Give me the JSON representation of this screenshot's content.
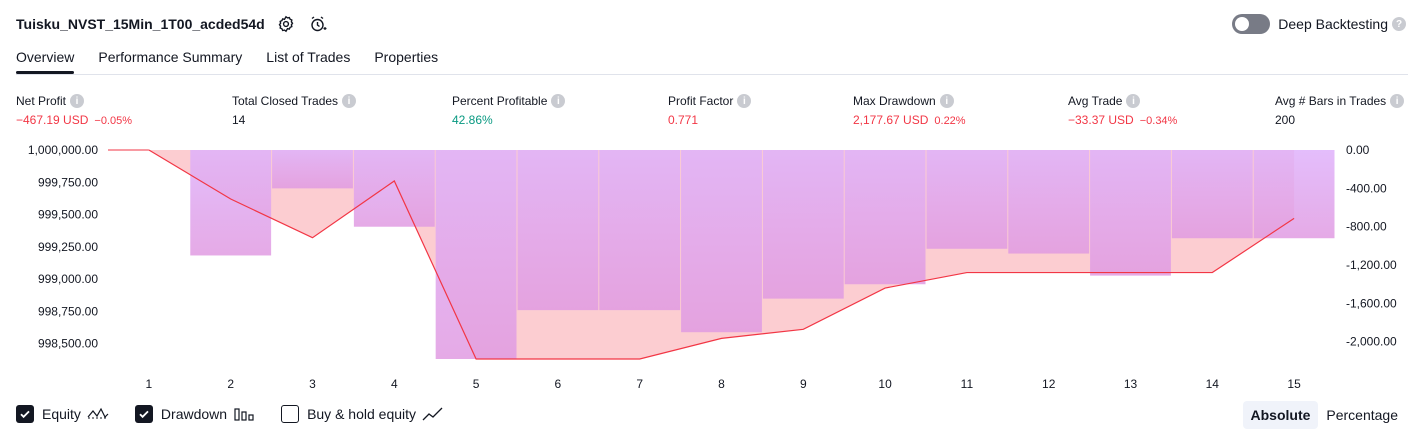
{
  "header": {
    "strategy_title": "Tuisku_NVST_15Min_1T00_acded54d",
    "deep_backtesting_label": "Deep Backtesting",
    "deep_backtesting_enabled": false
  },
  "tabs": [
    {
      "label": "Overview",
      "active": true
    },
    {
      "label": "Performance Summary",
      "active": false
    },
    {
      "label": "List of Trades",
      "active": false
    },
    {
      "label": "Properties",
      "active": false
    }
  ],
  "stats": [
    {
      "label": "Net Profit",
      "value": "−467.19 USD",
      "pct": "−0.05%",
      "tone": "neg"
    },
    {
      "label": "Total Closed Trades",
      "value": "14",
      "pct": "",
      "tone": "neu"
    },
    {
      "label": "Percent Profitable",
      "value": "42.86%",
      "pct": "",
      "tone": "pos"
    },
    {
      "label": "Profit Factor",
      "value": "0.771",
      "pct": "",
      "tone": "neg"
    },
    {
      "label": "Max Drawdown",
      "value": "2,177.67 USD",
      "pct": "0.22%",
      "tone": "neg"
    },
    {
      "label": "Avg Trade",
      "value": "−33.37 USD",
      "pct": "−0.34%",
      "tone": "neg"
    },
    {
      "label": "Avg # Bars in Trades",
      "value": "200",
      "pct": "",
      "tone": "neu"
    }
  ],
  "chart_data": {
    "type": "line",
    "x": [
      1,
      2,
      3,
      4,
      5,
      6,
      7,
      8,
      9,
      10,
      11,
      12,
      13,
      14,
      15
    ],
    "left_axis": {
      "ticks": [
        "1,000,000.00",
        "999,750.00",
        "999,500.00",
        "999,250.00",
        "999,000.00",
        "998,750.00",
        "998,500.00"
      ],
      "tick_values": [
        1000000,
        999750,
        999500,
        999250,
        999000,
        998750,
        998500
      ],
      "ylim": [
        998380,
        1000000
      ]
    },
    "right_axis": {
      "ticks": [
        "0.00",
        "-400.00",
        "-800.00",
        "-1,200.00",
        "-1,600.00",
        "-2,000.00"
      ],
      "tick_values": [
        0,
        -400,
        -800,
        -1200,
        -1600,
        -2000
      ],
      "ylim": [
        -2180,
        0
      ]
    },
    "series": [
      {
        "name": "Equity",
        "axis": "left",
        "values": [
          1000000,
          999620,
          999320,
          999760,
          998380,
          998380,
          998380,
          998540,
          998610,
          998930,
          999050,
          999050,
          999050,
          999050,
          999470
        ]
      },
      {
        "name": "Drawdown",
        "axis": "right",
        "values": [
          0,
          -1100,
          -400,
          -800,
          -2180,
          -1670,
          -1670,
          -1900,
          -1550,
          -1400,
          -1030,
          -1080,
          -1310,
          -920,
          -920
        ]
      }
    ],
    "colors": {
      "equity_line": "#f23645",
      "equity_fill": "#fcc8cc",
      "drawdown_bar": "#d9a8ff",
      "drawdown_bar_gradient": "#e985b8",
      "axis_text": "#131722"
    }
  },
  "legend": [
    {
      "label": "Equity",
      "checked": true,
      "icon": "equity-line-icon"
    },
    {
      "label": "Drawdown",
      "checked": true,
      "icon": "drawdown-bars-icon"
    },
    {
      "label": "Buy & hold equity",
      "checked": false,
      "icon": "buy-hold-line-icon"
    }
  ],
  "mode": {
    "absolute_label": "Absolute",
    "percentage_label": "Percentage",
    "active": "absolute"
  }
}
